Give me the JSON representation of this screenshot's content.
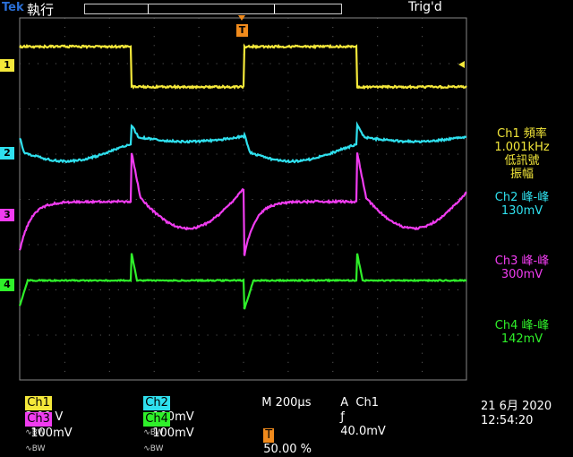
{
  "header": {
    "brand": "Tek",
    "run_state": "執行",
    "trigger_state": "Trig'd"
  },
  "markers": {
    "trigger_pos": "T",
    "ch1": "1",
    "ch2": "2",
    "ch3": "3",
    "ch4": "4"
  },
  "colors": {
    "ch1": "#f4e83a",
    "ch2": "#2fe0ee",
    "ch3": "#f03cf0",
    "ch4": "#2ff02a",
    "marker": "#f08a1c"
  },
  "measurements": [
    {
      "line1": "Ch1 頻率",
      "line2": "1.001kHz",
      "line3": "低訊號",
      "line4": "振幅",
      "color": "#f4e83a"
    },
    {
      "line1": "Ch2 峰-峰",
      "line2": "130mV",
      "color": "#2fe0ee"
    },
    {
      "line1": "Ch3 峰-峰",
      "line2": "300mV",
      "color": "#f03cf0"
    },
    {
      "line1": "Ch4 峰-峰",
      "line2": "142mV",
      "color": "#2ff02a"
    }
  ],
  "bottom": {
    "ch1_label": "Ch1",
    "ch1_scale": "2.00 V",
    "ch2_label": "Ch2",
    "ch2_scale": "100mV",
    "ch3_label": "Ch3",
    "ch3_scale": "100mV",
    "ch4_label": "Ch4",
    "ch4_scale": "100mV",
    "coupling": "∿BW",
    "timebase": "M 200µs",
    "trigger_source": "A  Ch1",
    "trigger_slope": "ƒ",
    "trigger_level": "40.0mV",
    "trigger_pos_label": "T",
    "trigger_pos": "50.00 %",
    "date": "21 6月  2020",
    "time": "12:54:20"
  }
}
